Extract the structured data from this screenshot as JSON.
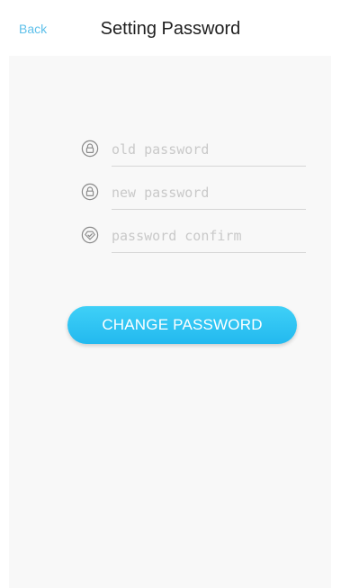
{
  "header": {
    "back_label": "Back",
    "title": "Setting Password"
  },
  "form": {
    "old_password": {
      "placeholder": "old password",
      "value": ""
    },
    "new_password": {
      "placeholder": "new password",
      "value": ""
    },
    "password_confirm": {
      "placeholder": "password confirm",
      "value": ""
    }
  },
  "actions": {
    "change_password_label": "CHANGE PASSWORD"
  },
  "colors": {
    "accent": "#23b9ef",
    "back_link": "#5ec0ea",
    "icon_stroke": "#8a8a8a"
  },
  "icons": {
    "old_password": "lock-icon",
    "new_password": "lock-icon",
    "password_confirm": "check-circle-icon"
  }
}
